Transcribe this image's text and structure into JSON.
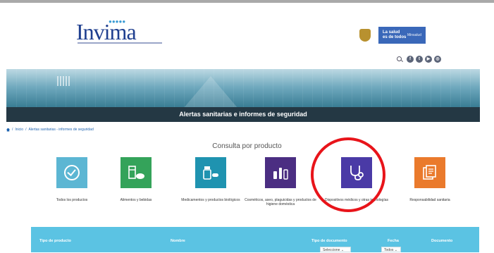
{
  "header": {
    "logo_text": "Invima",
    "gov_slogan_line1": "La salud",
    "gov_slogan_line2": "es de todos",
    "gov_ministry": "Minsalud"
  },
  "social": {
    "icons": [
      "search-icon",
      "facebook-icon",
      "twitter-icon",
      "youtube-icon",
      "instagram-icon"
    ],
    "glyphs": [
      "f",
      "t",
      "▶",
      "◎"
    ]
  },
  "banner": {
    "title": "Alertas sanitarias e informes de seguridad"
  },
  "breadcrumb": {
    "home": "Inicio",
    "separator": "/",
    "current": "Alertas sanitarias - informes de seguridad"
  },
  "section_title": "Consulta por producto",
  "products": [
    {
      "label": "Todos los productos",
      "color": "#5cb6d3"
    },
    {
      "label": "Alimentos y bebidas",
      "color": "#34a35a"
    },
    {
      "label": "Medicamentos y productos biológicos",
      "color": "#1f93b0"
    },
    {
      "label": "Cosméticos, aseo, plaguicidas y productos de higiene doméstica",
      "color": "#4b2e82"
    },
    {
      "label": "Dispositivos médicos y otras tecnologías",
      "color": "#4a3aa6"
    },
    {
      "label": "Responsabilidad sanitaria",
      "color": "#ea7a2c"
    }
  ],
  "table": {
    "headers": [
      "Tipo de producto",
      "Nombre",
      "Tipo de documento",
      "Fecha",
      "Documento"
    ],
    "doc_type_select": "Seleccione",
    "date_select": "Todos"
  },
  "colors": {
    "highlight": "#e8141a",
    "banner_bar": "#243844",
    "table_head": "#5bc3e3"
  }
}
